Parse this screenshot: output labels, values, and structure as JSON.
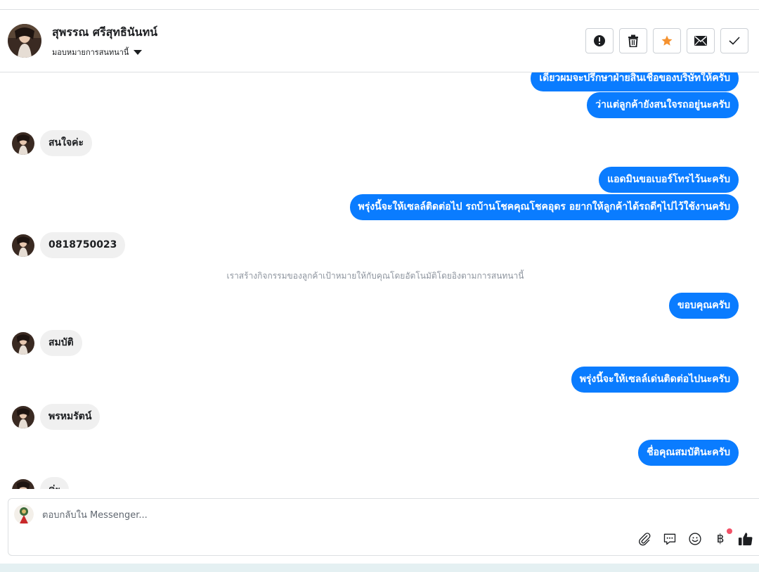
{
  "header": {
    "contact_name": "สุพรรณ ศรีสุทธินันทน์",
    "assign_label": "มอบหมายการสนทนานี้",
    "actions": [
      {
        "name": "spam",
        "icon": "exclamation-circle-icon"
      },
      {
        "name": "delete",
        "icon": "trash-icon"
      },
      {
        "name": "star",
        "icon": "star-icon"
      },
      {
        "name": "mark-unread",
        "icon": "envelope-icon"
      },
      {
        "name": "done",
        "icon": "checkmark-icon"
      }
    ],
    "star_color": "#f5922f"
  },
  "thread": {
    "outgoing_color": "#0a7cff",
    "messages": [
      {
        "dir": "out",
        "text": "เดี๋ยวผมจะปรึกษาฝ่ายสินเชื่อของบริษัทให้ครับ"
      },
      {
        "dir": "out",
        "text": "ว่าแต่ลูกค้ายังสนใจรถอยู่นะครับ"
      },
      {
        "dir": "in",
        "text": "สนใจค่ะ"
      },
      {
        "dir": "out",
        "text": "แอดมินขอเบอร์โทรไว้นะครับ"
      },
      {
        "dir": "out",
        "text": "พรุ่งนี้จะให้เซลล์ติดต่อไป รถบ้านโชคคุณโชคอุดร อยากให้ลูกค้าได้รถดีๆไปไว้ใช้งานครับ"
      },
      {
        "dir": "in",
        "text": "0818750023"
      },
      {
        "dir": "system",
        "text": "เราสร้างกิจกรรมของลูกค้าเป้าหมายให้กับคุณโดยอัตโนมัติโดยอิงตามการสนทนานี้"
      },
      {
        "dir": "out",
        "text": "ขอบคุณครับ"
      },
      {
        "dir": "in",
        "text": "สมบัติ"
      },
      {
        "dir": "out",
        "text": "พรุ่งนี้จะให้เซลล์เด่นติดต่อไปนะครับ"
      },
      {
        "dir": "in",
        "text": "พรหมรัตน์"
      },
      {
        "dir": "out",
        "text": "ชื่อคุณสมบัตินะครับ"
      },
      {
        "dir": "in",
        "text": "ค่ะ"
      }
    ]
  },
  "composer": {
    "placeholder": "ตอบกลับใน Messenger...",
    "tools": [
      "paperclip-icon",
      "saved-reply-icon",
      "emoji-icon",
      "baht-payment-icon",
      "thumbs-up-icon"
    ],
    "payment_symbol": "฿",
    "notification_dot_color": "#f25268"
  }
}
